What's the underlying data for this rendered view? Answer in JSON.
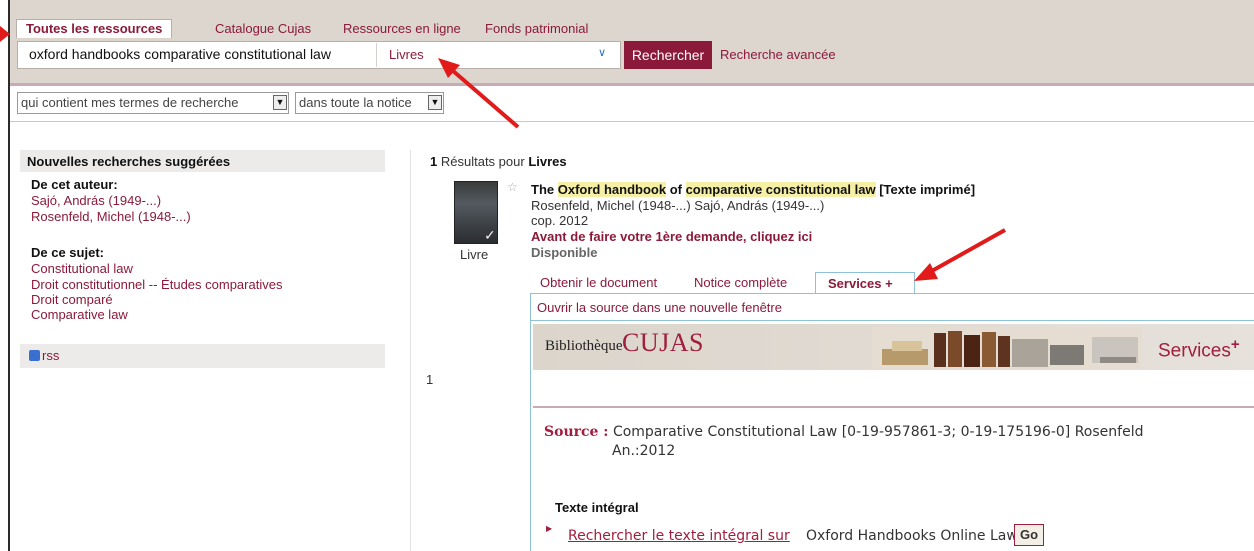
{
  "header": {
    "tabs": [
      {
        "label": "Toutes les ressources",
        "active": true
      },
      {
        "label": "Catalogue Cujas"
      },
      {
        "label": "Ressources en ligne"
      },
      {
        "label": "Fonds patrimonial"
      }
    ],
    "search": {
      "query": "oxford handbooks comparative constitutional law",
      "scope": "Livres"
    },
    "search_button": "Rechercher",
    "advanced_link": "Recherche avancée"
  },
  "filters": {
    "contains": "qui contient mes termes de recherche",
    "field": "dans toute la notice"
  },
  "sidebar": {
    "title": "Nouvelles recherches suggérées",
    "author_heading": "De cet auteur:",
    "authors": [
      "Sajó, András (1949-...)",
      "Rosenfeld, Michel (1948-...)"
    ],
    "subject_heading": "De ce sujet:",
    "subjects": [
      "Constitutional law",
      "Droit constitutionnel -- Études comparatives",
      "Droit comparé",
      "Comparative law"
    ],
    "rss": "rss"
  },
  "results": {
    "count": "1",
    "label": "Résultats pour",
    "scope": "Livres",
    "row_number": "1",
    "record": {
      "cover_label": "Livre",
      "title_parts": [
        "The ",
        "Oxford handbook",
        " of ",
        "comparative constitutional law",
        " [Texte imprimé]"
      ],
      "authors": "Rosenfeld, Michel (1948-...) Sajó, András (1949-...)",
      "date": "cop. 2012",
      "note": "Avant de faire votre 1ère demande, cliquez ici",
      "availability": "Disponible",
      "tabs": [
        "Obtenir le document",
        "Notice complète",
        "Services +"
      ],
      "panel": {
        "open_link": "Ouvrir la source dans une nouvelle fenêtre",
        "banner_prefix": "Bibliothèque",
        "banner_name": "CUJAS",
        "banner_services": "Services",
        "banner_plus": "+",
        "source_label": "Source :",
        "source_line1": "Comparative Constitutional Law [0-19-957861-3; 0-19-175196-0] Rosenfeld",
        "source_line2": "An.:2012",
        "fulltext_heading": "Texte intégral",
        "fulltext_link": "Rechercher le texte intégral sur",
        "fulltext_target": "Oxford Handbooks Online Law",
        "go_button": "Go"
      }
    }
  },
  "colors": {
    "accent": "#8b1a3a",
    "header_bg": "#ddd6ce",
    "arrow": "#e11a1a",
    "panel_border": "#8fc2d8"
  }
}
